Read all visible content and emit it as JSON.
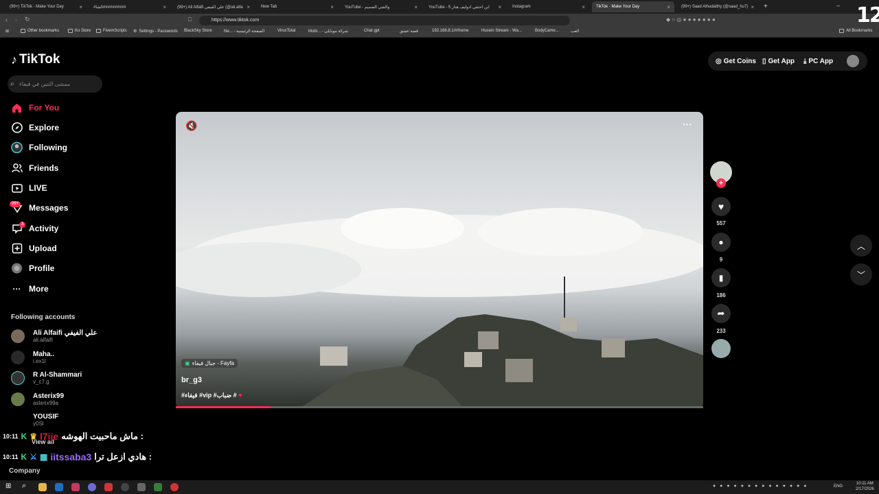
{
  "browser": {
    "tabs": [
      {
        "label": "(99+) TikTok - Make Your Day",
        "active": false
      },
      {
        "label": "#الشا##########",
        "active": false
      },
      {
        "label": "(99+) Ali Alfaifi علي الفيفي (@ali.alfa",
        "active": false
      },
      {
        "label": "New Tab",
        "active": false
      },
      {
        "label": "YouTube - والشي الصميم",
        "active": false
      },
      {
        "label": "YouTube - ابن احتفي ادوليف هتار 5",
        "active": false
      },
      {
        "label": "Instagram",
        "active": false
      },
      {
        "label": "TikTok - Make Your Day",
        "active": true
      },
      {
        "label": "(99+) Saad Alhudaithy (@saad_hu7)",
        "active": false
      }
    ],
    "url": "https://www.tiktok.com",
    "bookmarks": [
      "Other bookmarks",
      "Ko Store",
      "FivemScripts",
      "Settings - Passwords",
      "BlackSky Store",
      "Ne... - الصفحة الرئيسية",
      "VirusTotal",
      "Mobi... - شركة موبايلي",
      "Chat gpt",
      "قصة عشق",
      "192.168.8.1/#/home",
      "Husein Stream - Wa...",
      "BodyCame...",
      "العب"
    ],
    "all_bookmarks": "All Bookmarks"
  },
  "logo_text": "TikTok",
  "search": {
    "placeholder": "ممشى الثنين في فيفاء"
  },
  "nav": [
    {
      "label": "For You",
      "icon": "home-icon",
      "active": true
    },
    {
      "label": "Explore",
      "icon": "compass-icon"
    },
    {
      "label": "Following",
      "icon": "following-icon"
    },
    {
      "label": "Friends",
      "icon": "friends-icon"
    },
    {
      "label": "LIVE",
      "icon": "live-icon"
    },
    {
      "label": "Messages",
      "icon": "messages-icon",
      "badge": "99+"
    },
    {
      "label": "Activity",
      "icon": "activity-icon",
      "badge": "3"
    },
    {
      "label": "Upload",
      "icon": "upload-icon"
    },
    {
      "label": "Profile",
      "icon": "profile-icon"
    },
    {
      "label": "More",
      "icon": "more-icon"
    }
  ],
  "following": {
    "header": "Following accounts",
    "accounts": [
      {
        "name": "Ali Alfaifi علي الفيفي",
        "user": "ali.alfaifi"
      },
      {
        "name": "Maha..",
        "user": "i.ex1l"
      },
      {
        "name": "R Al-Shammari",
        "user": "v_c7.g"
      },
      {
        "name": "Asterix99",
        "user": "asterix99a"
      },
      {
        "name": "YOUSIF",
        "user": "y0Sl"
      }
    ],
    "view_all": "View all"
  },
  "company": "Company",
  "topbar": {
    "coins": "Get Coins",
    "app": "Get App",
    "pc": "PC App"
  },
  "video": {
    "location": "جبال فيفاء - Fayfa",
    "author": "br_g3",
    "caption": "#فيفاء #vip #ضباب #",
    "progress": 0.18,
    "likes": "557",
    "comments": "9",
    "saves": "186",
    "shares": "233"
  },
  "chat": [
    {
      "time": "10:11",
      "name": "l7ije",
      "name_color": "#d01b3a",
      "message": "ماش ماحبيت الهوشه :"
    },
    {
      "time": "10:11",
      "name": "iitssaba3",
      "name_color": "#9a6bff",
      "message": "هادي ازعل ترا :"
    }
  ],
  "taskbar": {
    "lang": "ENG",
    "time": "10:11 AM",
    "date": "2/17/2026"
  },
  "overlay_logo": "12",
  "colors": {
    "accent": "#fe2c55",
    "bg": "#000000"
  }
}
